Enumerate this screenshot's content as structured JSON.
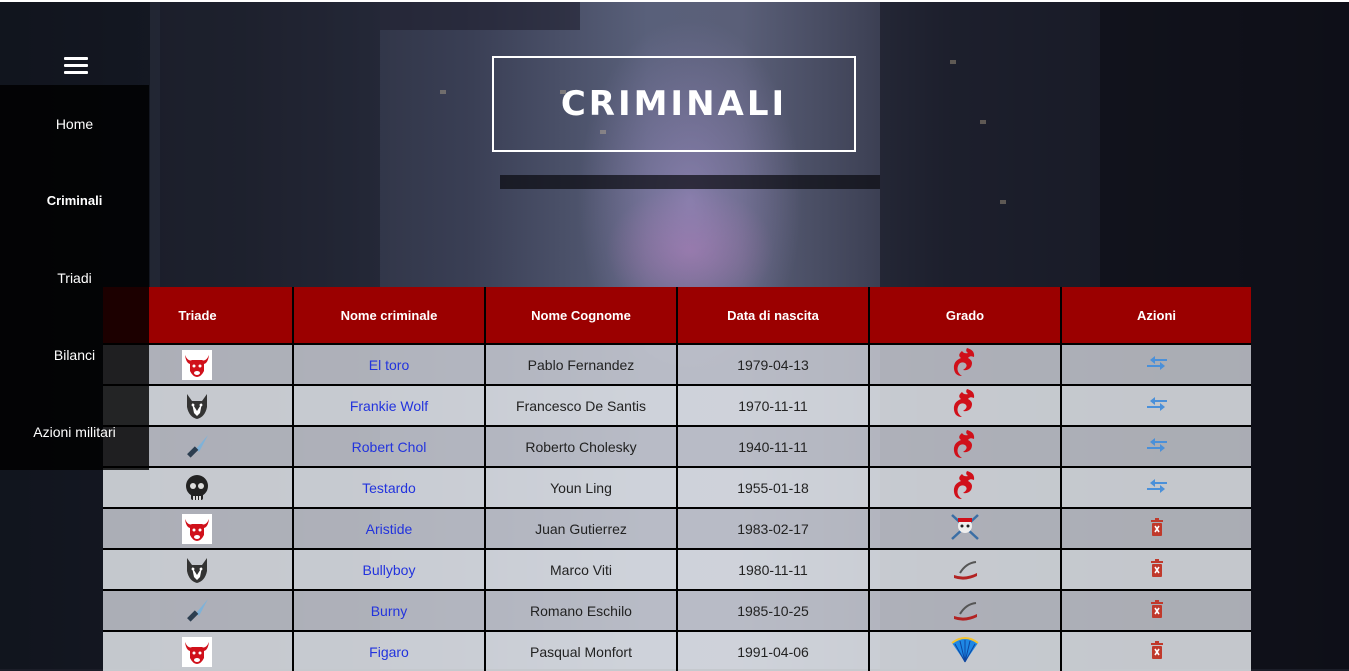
{
  "page": {
    "title": "CRIMINALI"
  },
  "sidebar": {
    "items": [
      {
        "label": "Home"
      },
      {
        "label": "Criminali"
      },
      {
        "label": "Triadi"
      },
      {
        "label": "Bilanci"
      },
      {
        "label": "Azioni militari"
      }
    ],
    "active": "Criminali"
  },
  "table": {
    "headers": [
      "Triade",
      "Nome criminale",
      "Nome Cognome",
      "Data di nascita",
      "Grado",
      "Azioni"
    ],
    "rows": [
      {
        "triade_icon": "bull-icon",
        "nickname": "El toro",
        "full_name": "Pablo Fernandez",
        "birth_date": "1979-04-13",
        "grade_icon": "red-dragon-icon",
        "action_icon": "transfer-arrows-icon"
      },
      {
        "triade_icon": "wolf-icon",
        "nickname": "Frankie Wolf",
        "full_name": "Francesco De Santis",
        "birth_date": "1970-11-11",
        "grade_icon": "red-dragon-icon",
        "action_icon": "transfer-arrows-icon"
      },
      {
        "triade_icon": "knife-icon",
        "nickname": "Robert Chol",
        "full_name": "Roberto Cholesky",
        "birth_date": "1940-11-11",
        "grade_icon": "red-dragon-icon",
        "action_icon": "transfer-arrows-icon"
      },
      {
        "triade_icon": "skull-icon",
        "nickname": "Testardo",
        "full_name": "Youn Ling",
        "birth_date": "1955-01-18",
        "grade_icon": "red-dragon-icon",
        "action_icon": "transfer-arrows-icon"
      },
      {
        "triade_icon": "bull-icon",
        "nickname": "Aristide",
        "full_name": "Juan Gutierrez",
        "birth_date": "1983-02-17",
        "grade_icon": "skull-crossed-swords-icon",
        "action_icon": "delete-bin-icon"
      },
      {
        "triade_icon": "wolf-icon",
        "nickname": "Bullyboy",
        "full_name": "Marco Viti",
        "birth_date": "1980-11-11",
        "grade_icon": "straw-sandal-icon",
        "action_icon": "delete-bin-icon"
      },
      {
        "triade_icon": "knife-icon",
        "nickname": "Burny",
        "full_name": "Romano Eschilo",
        "birth_date": "1985-10-25",
        "grade_icon": "straw-sandal-icon",
        "action_icon": "delete-bin-icon"
      },
      {
        "triade_icon": "bull-icon",
        "nickname": "Figaro",
        "full_name": "Pasqual Monfort",
        "birth_date": "1991-04-06",
        "grade_icon": "fan-icon",
        "action_icon": "delete-bin-icon"
      }
    ]
  },
  "colors": {
    "header_red": "#9b0000",
    "link_blue": "#2233dd",
    "dragon_red": "#d0101a",
    "action_blue": "#4a90d9",
    "delete_red": "#c0392b"
  }
}
